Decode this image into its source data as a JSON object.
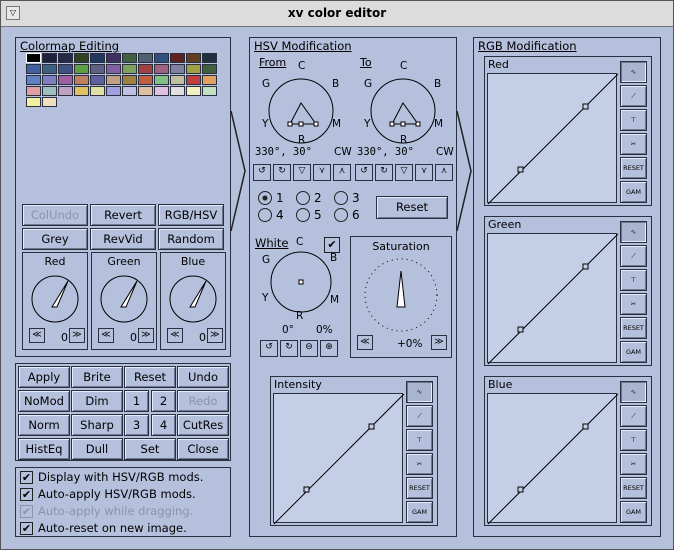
{
  "window": {
    "title": "xv color editor",
    "menu_icon": "window-menu-icon"
  },
  "colormap": {
    "title": "Colormap Editing",
    "swatches": [
      "#000000",
      "#202040",
      "#282848",
      "#304020",
      "#203860",
      "#403060",
      "#406040",
      "#506070",
      "#305080",
      "#602020",
      "#604020",
      "#203040",
      "#4060a0",
      "#406080",
      "#405080",
      "#60a040",
      "#606080",
      "#8060a0",
      "#80a060",
      "#a04040",
      "#a06080",
      "#8080a0",
      "#a0a040",
      "#406040",
      "#6080c0",
      "#8080c0",
      "#a060a0",
      "#c08060",
      "#6060a0",
      "#c0a080",
      "#a08040",
      "#c06040",
      "#80c080",
      "#c0c0a0",
      "#c04040",
      "#e0a060",
      "#e0a0a0",
      "#a0c0c0",
      "#c0a0c0",
      "#e0c060",
      "#e0e0a0",
      "#a0a0e0",
      "#c0c0e0",
      "#e0c0a0",
      "#e0c0e0",
      "#e0e0e0",
      "#f0f0c0",
      "#c0e0c0",
      "#f0f0a0",
      "#f0e0c0"
    ],
    "buttons": {
      "colundo": "ColUndo",
      "revert": "Revert",
      "rgbhsv": "RGB/HSV",
      "grey": "Grey",
      "revvid": "RevVid",
      "random": "Random"
    },
    "dials": [
      {
        "label": "Red",
        "value": "0"
      },
      {
        "label": "Green",
        "value": "0"
      },
      {
        "label": "Blue",
        "value": "0"
      }
    ]
  },
  "actions": {
    "apply": "Apply",
    "brite": "Brite",
    "reset": "Reset",
    "undo": "Undo",
    "nomod": "NoMod",
    "dim": "Dim",
    "one": "1",
    "two": "2",
    "redo": "Redo",
    "norm": "Norm",
    "sharp": "Sharp",
    "three": "3",
    "four": "4",
    "cutres": "CutRes",
    "histeq": "HistEq",
    "dull": "Dull",
    "set": "Set",
    "close": "Close"
  },
  "options": [
    {
      "label": "Display with HSV/RGB mods.",
      "checked": true,
      "disabled": false
    },
    {
      "label": "Auto-apply HSV/RGB mods.",
      "checked": true,
      "disabled": false
    },
    {
      "label": "Auto-apply while dragging.",
      "checked": true,
      "disabled": true
    },
    {
      "label": "Auto-reset on new image.",
      "checked": true,
      "disabled": false
    }
  ],
  "hsv": {
    "title": "HSV Modification",
    "from": {
      "label": "From",
      "readout": "330°, 30°",
      "dir": "CW"
    },
    "to": {
      "label": "To",
      "readout": "330°, 30°",
      "dir": "CW"
    },
    "wheel": {
      "c": "C",
      "b": "B",
      "m": "M",
      "r": "R",
      "y": "Y",
      "g": "G"
    },
    "radios": [
      "1",
      "2",
      "3",
      "4",
      "5",
      "6"
    ],
    "selected_radio": "1",
    "reset_label": "Reset",
    "white": {
      "label": "White",
      "hue": "0°",
      "sat": "0%",
      "checked": true
    },
    "saturation": {
      "label": "Saturation",
      "value": "+0%"
    },
    "intensity": {
      "label": "Intensity"
    }
  },
  "rgb": {
    "title": "RGB Modification",
    "curves": [
      {
        "label": "Red"
      },
      {
        "label": "Green"
      },
      {
        "label": "Blue"
      }
    ]
  },
  "curve_buttons": {
    "reset": "RESET",
    "gam": "GAM"
  }
}
